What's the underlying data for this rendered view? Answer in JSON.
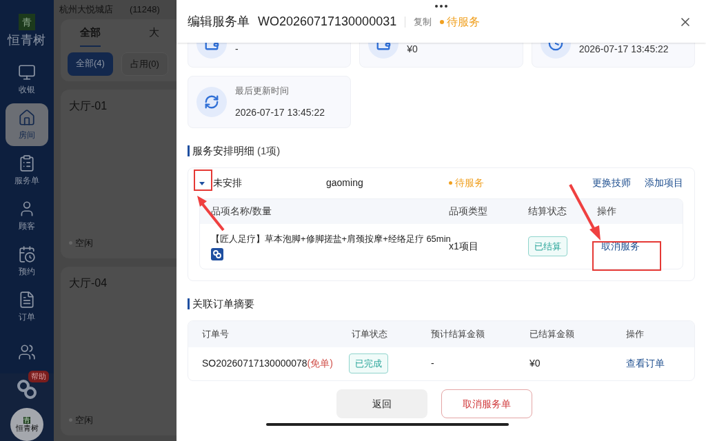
{
  "sidebar": {
    "logo_mark": "青",
    "logo_text": "恒青树",
    "items": [
      {
        "label": "收银",
        "selected": false
      },
      {
        "label": "房间",
        "selected": true
      },
      {
        "label": "服务单",
        "selected": false
      },
      {
        "label": "顾客",
        "selected": false
      },
      {
        "label": "预约",
        "selected": false
      },
      {
        "label": "订单",
        "selected": false
      },
      {
        "selected": false
      }
    ],
    "help_badge": "帮助",
    "avatar_mark": "青",
    "avatar_text": "恒青树"
  },
  "store": {
    "name": "杭州大悦城店",
    "code": "(11248)"
  },
  "room_tabs": [
    {
      "label": "全部",
      "selected": true
    },
    {
      "label": "大",
      "selected": false
    }
  ],
  "room_filters": [
    {
      "label": "全部(4)",
      "selected": true
    },
    {
      "label": "占用(0)",
      "selected": false
    }
  ],
  "rooms": [
    {
      "name": "大厅-01",
      "status": "空闲"
    },
    {
      "name": "大厅-04",
      "status": "空闲"
    }
  ],
  "drawer": {
    "title": "编辑服务单",
    "order_no": "WO20260717130000031",
    "copy": "复制",
    "status": "待服务",
    "info_cards": [
      {
        "value": "-"
      },
      {
        "value": "¥0"
      },
      {
        "value": "2026-07-17 13:45:22"
      },
      {
        "label": "最后更新时间",
        "value": "2026-07-17 13:45:22"
      }
    ],
    "service_section": {
      "title": "服务安排明细",
      "count": "(1项)",
      "group": {
        "expanded": true,
        "technician": "未安排",
        "staff": "gaoming",
        "status": "待服务",
        "links": [
          "更换技师",
          "添加项目"
        ],
        "columns": [
          "品项名称/数量",
          "品项类型",
          "结算状态",
          "操作"
        ],
        "items": [
          {
            "name": "【匠人足疗】草本泡脚+修脚搓盐+肩颈按摩+经络足疗 65min",
            "type": "x1项目",
            "settle": "已结算",
            "action": "取消服务"
          }
        ]
      }
    },
    "order_section": {
      "title": "关联订单摘要",
      "columns": [
        "订单号",
        "订单状态",
        "预计结算金额",
        "已结算金额",
        "操作"
      ],
      "rows": [
        {
          "order_no": "SO20260717130000078",
          "tag": "(免单)",
          "status": "已完成",
          "expected": "-",
          "settled": "¥0",
          "action": "查看订单"
        }
      ]
    },
    "buttons": [
      {
        "label": "返回",
        "kind": "secondary"
      },
      {
        "label": "取消服务单",
        "kind": "danger"
      }
    ]
  }
}
